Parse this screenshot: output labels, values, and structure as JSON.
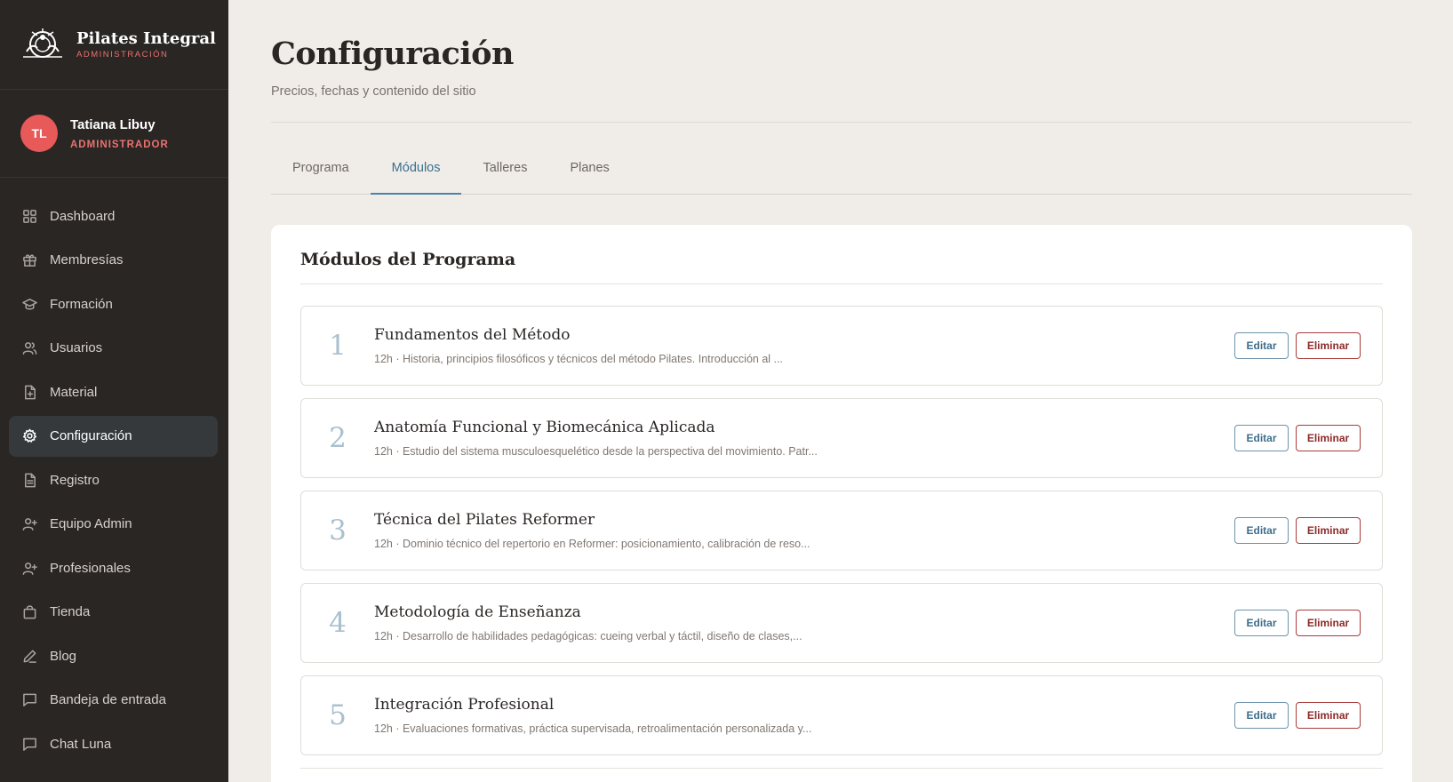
{
  "brand": {
    "name": "Pilates Integral",
    "subtitle": "ADMINISTRACIÓN"
  },
  "user": {
    "initials": "TL",
    "name": "Tatiana Libuy",
    "role": "ADMINISTRADOR"
  },
  "nav": [
    {
      "label": "Dashboard",
      "icon": "dashboard-icon"
    },
    {
      "label": "Membresías",
      "icon": "gift-icon"
    },
    {
      "label": "Formación",
      "icon": "graduation-cap-icon"
    },
    {
      "label": "Usuarios",
      "icon": "users-icon"
    },
    {
      "label": "Material",
      "icon": "file-plus-icon"
    },
    {
      "label": "Configuración",
      "icon": "gear-icon",
      "active": true
    },
    {
      "label": "Registro",
      "icon": "document-icon"
    },
    {
      "label": "Equipo Admin",
      "icon": "user-plus-icon"
    },
    {
      "label": "Profesionales",
      "icon": "user-plus-icon"
    },
    {
      "label": "Tienda",
      "icon": "shopping-bag-icon"
    },
    {
      "label": "Blog",
      "icon": "pencil-icon"
    },
    {
      "label": "Bandeja de entrada",
      "icon": "message-icon"
    },
    {
      "label": "Chat Luna",
      "icon": "message-icon"
    }
  ],
  "page": {
    "title": "Configuración",
    "subtitle": "Precios, fechas y contenido del sitio"
  },
  "tabs": [
    {
      "label": "Programa"
    },
    {
      "label": "Módulos",
      "active": true
    },
    {
      "label": "Talleres"
    },
    {
      "label": "Planes"
    }
  ],
  "card": {
    "title": "Módulos del Programa"
  },
  "modules": [
    {
      "num": "1",
      "title": "Fundamentos del Método",
      "desc": "12h · Historia, principios filosóficos y técnicos del método Pilates. Introducción al ..."
    },
    {
      "num": "2",
      "title": "Anatomía Funcional y Biomecánica Aplicada",
      "desc": "12h · Estudio del sistema musculoesquelético desde la perspectiva del movimiento. Patr..."
    },
    {
      "num": "3",
      "title": "Técnica del Pilates Reformer",
      "desc": "12h · Dominio técnico del repertorio en Reformer: posicionamiento, calibración de reso..."
    },
    {
      "num": "4",
      "title": "Metodología de Enseñanza",
      "desc": "12h · Desarrollo de habilidades pedagógicas: cueing verbal y táctil, diseño de clases,..."
    },
    {
      "num": "5",
      "title": "Integración Profesional",
      "desc": "12h · Evaluaciones formativas, práctica supervisada, retroalimentación personalizada y..."
    }
  ],
  "actions": {
    "edit_label": "Editar",
    "delete_label": "Eliminar"
  },
  "colors": {
    "sidebar_bg": "#2a2624",
    "accent": "#e9736f",
    "tab_active": "#3a6f8f",
    "delete": "#8e2a2a"
  }
}
